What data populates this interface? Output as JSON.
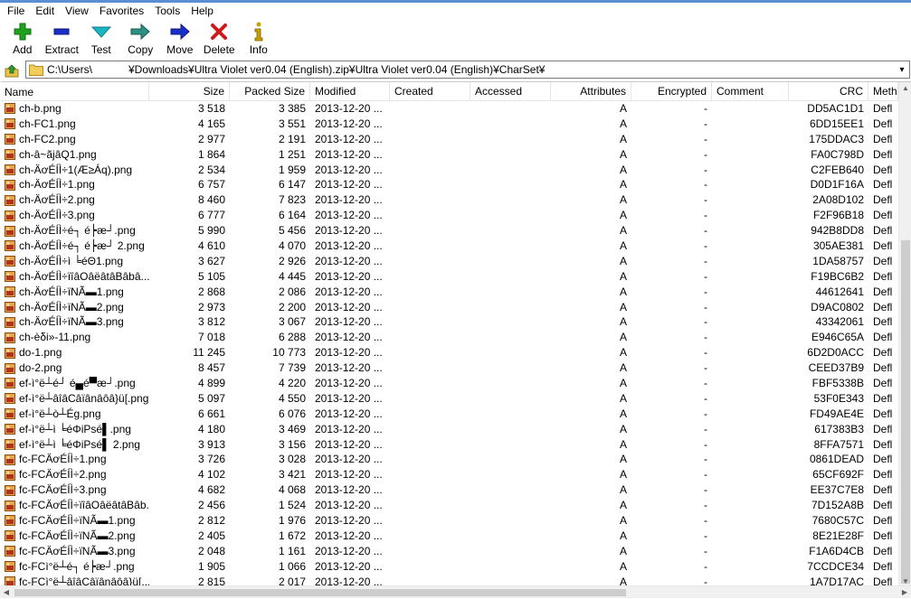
{
  "menu": [
    "File",
    "Edit",
    "View",
    "Favorites",
    "Tools",
    "Help"
  ],
  "toolbar": [
    {
      "label": "Add",
      "icon": "add-icon",
      "color": "#1fa31f"
    },
    {
      "label": "Extract",
      "icon": "extract-icon",
      "color": "#1a2fc8"
    },
    {
      "label": "Test",
      "icon": "test-icon",
      "color": "#19b5c4"
    },
    {
      "label": "Copy",
      "icon": "copy-icon",
      "color": "#2e8f83"
    },
    {
      "label": "Move",
      "icon": "move-icon",
      "color": "#1a2fc8"
    },
    {
      "label": "Delete",
      "icon": "delete-icon",
      "color": "#d01818"
    },
    {
      "label": "Info",
      "icon": "info-icon",
      "color": "#c8a000"
    }
  ],
  "address": {
    "path": "C:\\Users\\            ¥Downloads¥Ultra Violet ver0.04 (English).zip¥Ultra Violet ver0.04 (English)¥CharSet¥"
  },
  "columns": [
    "Name",
    "Size",
    "Packed Size",
    "Modified",
    "Created",
    "Accessed",
    "Attributes",
    "Encrypted",
    "Comment",
    "CRC",
    "Meth"
  ],
  "files": [
    {
      "name": "ch-b.png",
      "size": "3 518",
      "packed": "3 385",
      "modified": "2013-12-20 ...",
      "attr": "A",
      "enc": "-",
      "crc": "DD5AC1D1",
      "method": "Defl"
    },
    {
      "name": "ch-FC1.png",
      "size": "4 165",
      "packed": "3 551",
      "modified": "2013-12-20 ...",
      "attr": "A",
      "enc": "-",
      "crc": "6DD15EE1",
      "method": "Defl"
    },
    {
      "name": "ch-FC2.png",
      "size": "2 977",
      "packed": "2 191",
      "modified": "2013-12-20 ...",
      "attr": "A",
      "enc": "-",
      "crc": "175DDAC3",
      "method": "Defl"
    },
    {
      "name": "ch-â~ãjâQ1.png",
      "size": "1 864",
      "packed": "1 251",
      "modified": "2013-12-20 ...",
      "attr": "A",
      "enc": "-",
      "crc": "FA0C798D",
      "method": "Defl"
    },
    {
      "name": "ch-ÄơÉÍÌ÷1(Æ≥Áq).png",
      "size": "2 534",
      "packed": "1 959",
      "modified": "2013-12-20 ...",
      "attr": "A",
      "enc": "-",
      "crc": "C2FEB640",
      "method": "Defl"
    },
    {
      "name": "ch-ÄơÉÍÌ÷1.png",
      "size": "6 757",
      "packed": "6 147",
      "modified": "2013-12-20 ...",
      "attr": "A",
      "enc": "-",
      "crc": "D0D1F16A",
      "method": "Defl"
    },
    {
      "name": "ch-ÄơÉÍÌ÷2.png",
      "size": "8 460",
      "packed": "7 823",
      "modified": "2013-12-20 ...",
      "attr": "A",
      "enc": "-",
      "crc": "2A08D102",
      "method": "Defl"
    },
    {
      "name": "ch-ÄơÉÍÌ÷3.png",
      "size": "6 777",
      "packed": "6 164",
      "modified": "2013-12-20 ...",
      "attr": "A",
      "enc": "-",
      "crc": "F2F96B18",
      "method": "Defl"
    },
    {
      "name": "ch-ÄơÉÍÌ÷é┐ é┝æ┘.png",
      "size": "5 990",
      "packed": "5 456",
      "modified": "2013-12-20 ...",
      "attr": "A",
      "enc": "-",
      "crc": "942B8DD8",
      "method": "Defl"
    },
    {
      "name": "ch-ÄơÉÍÌ÷é┐ é┝æ┘ 2.png",
      "size": "4 610",
      "packed": "4 070",
      "modified": "2013-12-20 ...",
      "attr": "A",
      "enc": "-",
      "crc": "305AE381",
      "method": "Defl"
    },
    {
      "name": "ch-ÄơÉÍÌ÷ì ╘éΘ1.png",
      "size": "3 627",
      "packed": "2 926",
      "modified": "2013-12-20 ...",
      "attr": "A",
      "enc": "-",
      "crc": "1DA58757",
      "method": "Defl"
    },
    {
      "name": "ch-ÄơÉÍÌ÷ïîâOâëâtâBâbâ...",
      "size": "5 105",
      "packed": "4 445",
      "modified": "2013-12-20 ...",
      "attr": "A",
      "enc": "-",
      "crc": "F19BC6B2",
      "method": "Defl"
    },
    {
      "name": "ch-ÄơÉÍÌ÷ïNÃ▬1.png",
      "size": "2 868",
      "packed": "2 086",
      "modified": "2013-12-20 ...",
      "attr": "A",
      "enc": "-",
      "crc": "44612641",
      "method": "Defl"
    },
    {
      "name": "ch-ÄơÉÍÌ÷ïNÃ▬2.png",
      "size": "2 973",
      "packed": "2 200",
      "modified": "2013-12-20 ...",
      "attr": "A",
      "enc": "-",
      "crc": "D9AC0802",
      "method": "Defl"
    },
    {
      "name": "ch-ÄơÉÍÌ÷ïNÃ▬3.png",
      "size": "3 812",
      "packed": "3 067",
      "modified": "2013-12-20 ...",
      "attr": "A",
      "enc": "-",
      "crc": "43342061",
      "method": "Defl"
    },
    {
      "name": "ch-èδi»-11.png",
      "size": "7 018",
      "packed": "6 288",
      "modified": "2013-12-20 ...",
      "attr": "A",
      "enc": "-",
      "crc": "E946C65A",
      "method": "Defl"
    },
    {
      "name": "do-1.png",
      "size": "11 245",
      "packed": "10 773",
      "modified": "2013-12-20 ...",
      "attr": "A",
      "enc": "-",
      "crc": "6D2D0ACC",
      "method": "Defl"
    },
    {
      "name": "do-2.png",
      "size": "8 457",
      "packed": "7 739",
      "modified": "2013-12-20 ...",
      "attr": "A",
      "enc": "-",
      "crc": "CEED37B9",
      "method": "Defl"
    },
    {
      "name": "ef-ì°ë┴é┘ é▄é▀æ┘.png",
      "size": "4 899",
      "packed": "4 220",
      "modified": "2013-12-20 ...",
      "attr": "A",
      "enc": "-",
      "crc": "FBF5338B",
      "method": "Defl"
    },
    {
      "name": "ef-ì°ë┴âîâCâïânâôâ}ü[.png",
      "size": "5 097",
      "packed": "4 550",
      "modified": "2013-12-20 ...",
      "attr": "A",
      "enc": "-",
      "crc": "53F0E343",
      "method": "Defl"
    },
    {
      "name": "ef-ì°ë┴ò┴Ég.png",
      "size": "6 661",
      "packed": "6 076",
      "modified": "2013-12-20 ...",
      "attr": "A",
      "enc": "-",
      "crc": "FD49AE4E",
      "method": "Defl"
    },
    {
      "name": "ef-ì°ë┴ì ╘éΦiPsé▌.png",
      "size": "4 180",
      "packed": "3 469",
      "modified": "2013-12-20 ...",
      "attr": "A",
      "enc": "-",
      "crc": "617383B3",
      "method": "Defl"
    },
    {
      "name": "ef-ì°ë┴ì ╘éΦiPsé▌ 2.png",
      "size": "3 913",
      "packed": "3 156",
      "modified": "2013-12-20 ...",
      "attr": "A",
      "enc": "-",
      "crc": "8FFA7571",
      "method": "Defl"
    },
    {
      "name": "fc-FCÄơÉÍÌ÷1.png",
      "size": "3 726",
      "packed": "3 028",
      "modified": "2013-12-20 ...",
      "attr": "A",
      "enc": "-",
      "crc": "0861DEAD",
      "method": "Defl"
    },
    {
      "name": "fc-FCÄơÉÍÌ÷2.png",
      "size": "4 102",
      "packed": "3 421",
      "modified": "2013-12-20 ...",
      "attr": "A",
      "enc": "-",
      "crc": "65CF692F",
      "method": "Defl"
    },
    {
      "name": "fc-FCÄơÉÍÌ÷3.png",
      "size": "4 682",
      "packed": "4 068",
      "modified": "2013-12-20 ...",
      "attr": "A",
      "enc": "-",
      "crc": "EE37C7E8",
      "method": "Defl"
    },
    {
      "name": "fc-FCÄơÉÍÌ÷ïîâOâëâtâBâb...",
      "size": "2 456",
      "packed": "1 524",
      "modified": "2013-12-20 ...",
      "attr": "A",
      "enc": "-",
      "crc": "7D152A8B",
      "method": "Defl"
    },
    {
      "name": "fc-FCÄơÉÍÌ÷ïNÃ▬1.png",
      "size": "2 812",
      "packed": "1 976",
      "modified": "2013-12-20 ...",
      "attr": "A",
      "enc": "-",
      "crc": "7680C57C",
      "method": "Defl"
    },
    {
      "name": "fc-FCÄơÉÍÌ÷ïNÃ▬2.png",
      "size": "2 405",
      "packed": "1 672",
      "modified": "2013-12-20 ...",
      "attr": "A",
      "enc": "-",
      "crc": "8E21E28F",
      "method": "Defl"
    },
    {
      "name": "fc-FCÄơÉÍÌ÷ïNÃ▬3.png",
      "size": "2 048",
      "packed": "1 161",
      "modified": "2013-12-20 ...",
      "attr": "A",
      "enc": "-",
      "crc": "F1A6D4CB",
      "method": "Defl"
    },
    {
      "name": "fc-FCì°ë┴é┐ é┝æ┘.png",
      "size": "1 905",
      "packed": "1 066",
      "modified": "2013-12-20 ...",
      "attr": "A",
      "enc": "-",
      "crc": "7CCDCE34",
      "method": "Defl"
    },
    {
      "name": "fc-FCì°ë┴âîâCâïânâôâ}ü[...",
      "size": "2 815",
      "packed": "2 017",
      "modified": "2013-12-20 ...",
      "attr": "A",
      "enc": "-",
      "crc": "1A7D17AC",
      "method": "Defl"
    }
  ]
}
